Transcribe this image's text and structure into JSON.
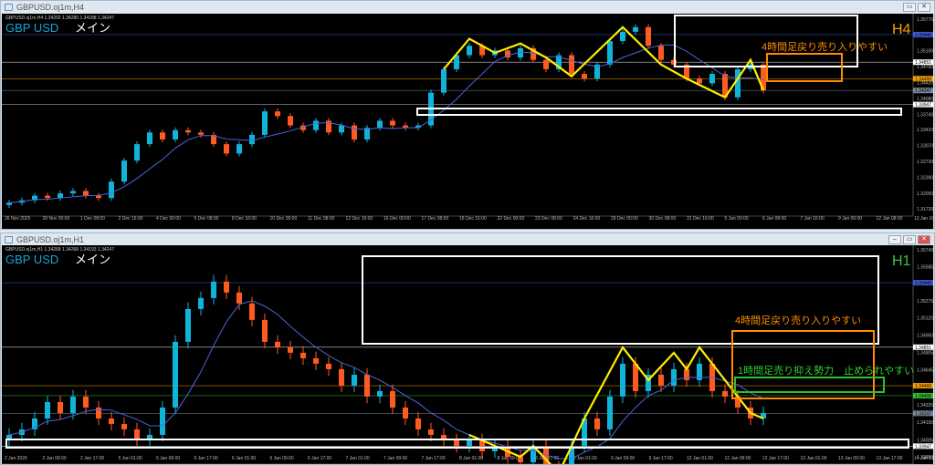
{
  "windows": [
    {
      "title": "GBPUSD.oj1m,H4",
      "ohlc": "GBPUSD.oj1m,H4  1.34202 1.34280 1.34188 1.34247",
      "symbol": "GBP USD",
      "label": "メイン",
      "timeframe": "H4",
      "note": "4時間足戻り売り入りやすい"
    },
    {
      "title": "GBPUSD.oj1m,H1",
      "ohlc": "GBPUSD.oj1m,H1  1.34268 1.34268 1.34193 1.34247",
      "symbol": "GBP USD",
      "label": "メイン",
      "timeframe": "H1",
      "note": "4時間足戻り売り入りやすい",
      "note2": "1時間足売り抑え勢力　止められやすい"
    }
  ],
  "chart_data": [
    {
      "type": "candlestick",
      "title": "GBPUSD.oj1m,H4",
      "ylim": [
        1.3172,
        1.3577
      ],
      "yticks": [
        "1.35770",
        "1.35100",
        "1.34760",
        "1.34420",
        "1.34080",
        "1.33740",
        "1.33410",
        "1.33070",
        "1.32730",
        "1.32390",
        "1.32050",
        "1.31720"
      ],
      "price_tags": [
        {
          "v": "1.35440",
          "p": 1.3544,
          "color": "#3a5bd0"
        },
        {
          "v": "1.34851",
          "p": 1.34851,
          "color": "#ffffff"
        },
        {
          "v": "1.34499",
          "p": 1.34499,
          "color": "#f5a000"
        },
        {
          "v": "1.34247",
          "p": 1.34247,
          "color": "#778899"
        },
        {
          "v": "1.33947",
          "p": 1.33947,
          "color": "#ffffff"
        }
      ],
      "xticks": [
        "26 Nov 2025",
        "28 Nov 00:00",
        "1 Dec 08:00",
        "2 Dec 16:00",
        "4 Dec 00:00",
        "5 Dec 08:00",
        "8 Dec 16:00",
        "10 Dec 00:00",
        "11 Dec 08:00",
        "12 Dec 16:00",
        "16 Dec 00:00",
        "17 Dec 08:00",
        "18 Dec 16:00",
        "22 Dec 00:00",
        "23 Dec 08:00",
        "24 Dec 16:00",
        "29 Dec 00:00",
        "30 Dec 08:00",
        "31 Dec 16:00",
        "5 Jan 00:00",
        "6 Jan 08:00",
        "7 Jan 16:00",
        "9 Jan 00:00",
        "12 Jan 08:00",
        "13 Jan 16:00"
      ],
      "close": [
        1.3185,
        1.319,
        1.32,
        1.3195,
        1.3205,
        1.321,
        1.32,
        1.3195,
        1.323,
        1.3275,
        1.331,
        1.3335,
        1.332,
        1.334,
        1.3335,
        1.333,
        1.331,
        1.329,
        1.331,
        1.333,
        1.338,
        1.337,
        1.335,
        1.334,
        1.336,
        1.3335,
        1.335,
        1.332,
        1.3345,
        1.336,
        1.335,
        1.3345,
        1.335,
        1.342,
        1.347,
        1.35,
        1.352,
        1.35,
        1.351,
        1.3495,
        1.3515,
        1.349,
        1.347,
        1.35,
        1.346,
        1.345,
        1.348,
        1.353,
        1.355,
        1.356,
        1.352,
        1.349,
        1.348,
        1.345,
        1.344,
        1.346,
        1.341,
        1.347,
        1.348,
        1.3425
      ],
      "zigzag": [
        [
          34,
          1.347
        ],
        [
          36,
          1.3535
        ],
        [
          38,
          1.3505
        ],
        [
          40,
          1.3525
        ],
        [
          42,
          1.3495
        ],
        [
          44,
          1.3455
        ],
        [
          48,
          1.356
        ],
        [
          51,
          1.348
        ],
        [
          53,
          1.345
        ],
        [
          56,
          1.341
        ],
        [
          58,
          1.349
        ],
        [
          59,
          1.3425
        ]
      ]
    },
    {
      "type": "candlestick",
      "title": "GBPUSD.oj1m,H1",
      "ylim": [
        1.3385,
        1.3574
      ],
      "yticks": [
        "1.35740",
        "1.35585",
        "1.35275",
        "1.35120",
        "1.34960",
        "1.34805",
        "1.34645",
        "1.34325",
        "1.34165",
        "1.34005",
        "1.33850"
      ],
      "price_tags": [
        {
          "v": "1.35440",
          "p": 1.3544,
          "color": "#3a5bd0"
        },
        {
          "v": "1.34851",
          "p": 1.34851,
          "color": "#ffffff"
        },
        {
          "v": "1.34499",
          "p": 1.34499,
          "color": "#f5a000"
        },
        {
          "v": "1.34408",
          "p": 1.34408,
          "color": "#2fbf2f"
        },
        {
          "v": "1.34247",
          "p": 1.34247,
          "color": "#778899"
        },
        {
          "v": "1.33947",
          "p": 1.33947,
          "color": "#ffffff"
        }
      ],
      "xticks": [
        "2 Jan 2026",
        "2 Jan 09:00",
        "2 Jan 17:00",
        "5 Jan 01:00",
        "5 Jan 09:00",
        "5 Jan 17:00",
        "6 Jan 01:00",
        "6 Jan 09:00",
        "6 Jan 17:00",
        "7 Jan 01:00",
        "7 Jan 09:00",
        "7 Jan 17:00",
        "8 Jan 01:00",
        "8 Jan 09:00",
        "8 Jan 17:00",
        "9 Jan 01:00",
        "9 Jan 09:00",
        "9 Jan 17:00",
        "12 Jan 01:00",
        "12 Jan 09:00",
        "12 Jan 17:00",
        "13 Jan 01:00",
        "13 Jan 09:00",
        "13 Jan 17:00",
        "14 Jan 01:00"
      ],
      "close": [
        1.3405,
        1.341,
        1.342,
        1.3435,
        1.3425,
        1.344,
        1.343,
        1.342,
        1.3415,
        1.341,
        1.34,
        1.3405,
        1.343,
        1.349,
        1.352,
        1.353,
        1.3545,
        1.3535,
        1.3525,
        1.351,
        1.349,
        1.3485,
        1.348,
        1.3475,
        1.347,
        1.3465,
        1.345,
        1.346,
        1.344,
        1.3445,
        1.343,
        1.342,
        1.341,
        1.3405,
        1.34,
        1.3395,
        1.34,
        1.339,
        1.3395,
        1.3385,
        1.338,
        1.3395,
        1.3375,
        1.337,
        1.3395,
        1.342,
        1.341,
        1.344,
        1.347,
        1.3445,
        1.346,
        1.345,
        1.3465,
        1.3455,
        1.347,
        1.3445,
        1.344,
        1.343,
        1.342,
        1.3425
      ],
      "zigzag": [
        [
          36,
          1.3405
        ],
        [
          40,
          1.3385
        ],
        [
          41,
          1.3395
        ],
        [
          43,
          1.337
        ],
        [
          45,
          1.342
        ],
        [
          48,
          1.3485
        ],
        [
          50,
          1.3455
        ],
        [
          52,
          1.348
        ],
        [
          53,
          1.3465
        ],
        [
          54,
          1.3485
        ],
        [
          57,
          1.344
        ],
        [
          58,
          1.3425
        ],
        [
          59,
          1.342
        ]
      ]
    }
  ]
}
